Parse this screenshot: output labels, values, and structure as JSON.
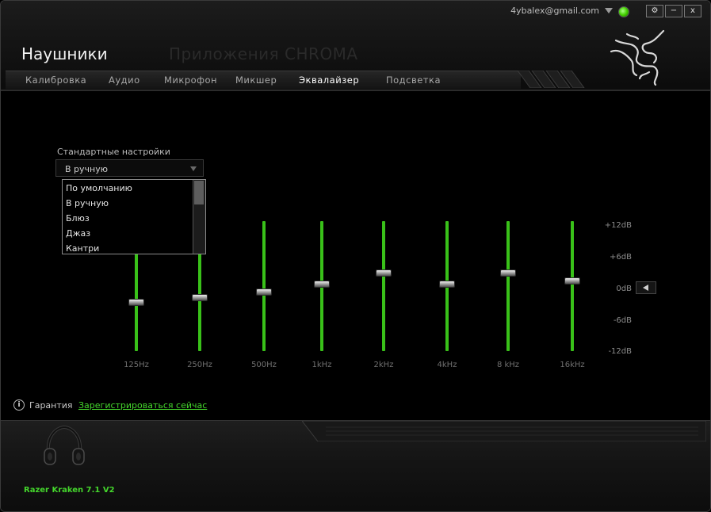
{
  "header": {
    "account_email": "4ybalex@gmail.com",
    "window_buttons": [
      {
        "icon": "gear-icon",
        "label": "⚙"
      },
      {
        "icon": "minimize-icon",
        "label": "−"
      },
      {
        "icon": "close-icon",
        "label": "x"
      }
    ],
    "title": "Наушники",
    "chroma_label": "Приложения CHROMA"
  },
  "tabs": [
    {
      "label": "Калибровка",
      "active": false
    },
    {
      "label": "Аудио",
      "active": false
    },
    {
      "label": "Микрофон",
      "active": false
    },
    {
      "label": "Микшер",
      "active": false
    },
    {
      "label": "Эквалайзер",
      "active": true
    },
    {
      "label": "Подсветка",
      "active": false
    }
  ],
  "presets": {
    "label": "Стандартные настройки",
    "selected": "В ручную",
    "options": [
      "По умолчанию",
      "В ручную",
      "Блюз",
      "Джаз",
      "Кантри"
    ]
  },
  "equalizer": {
    "bands": [
      {
        "label": "125Hz",
        "gain_db": -3
      },
      {
        "label": "250Hz",
        "gain_db": -2
      },
      {
        "label": "500Hz",
        "gain_db": -1
      },
      {
        "label": "1kHz",
        "gain_db": 0.5
      },
      {
        "label": "2kHz",
        "gain_db": 2.5
      },
      {
        "label": "4kHz",
        "gain_db": 0.5
      },
      {
        "label": "8 kHz",
        "gain_db": 2.5
      },
      {
        "label": "16kHz",
        "gain_db": 1
      }
    ],
    "scale_labels": [
      "+12dB",
      "+6dB",
      "0dB",
      "-6dB",
      "-12dB"
    ],
    "range_db": [
      -12,
      12
    ],
    "accent_color": "#39c119"
  },
  "warranty": {
    "label": "Гарантия",
    "link": "Зарегистрироваться сейчас"
  },
  "device": {
    "name": "Razer Kraken 7.1 V2",
    "icon": "headset-icon"
  }
}
